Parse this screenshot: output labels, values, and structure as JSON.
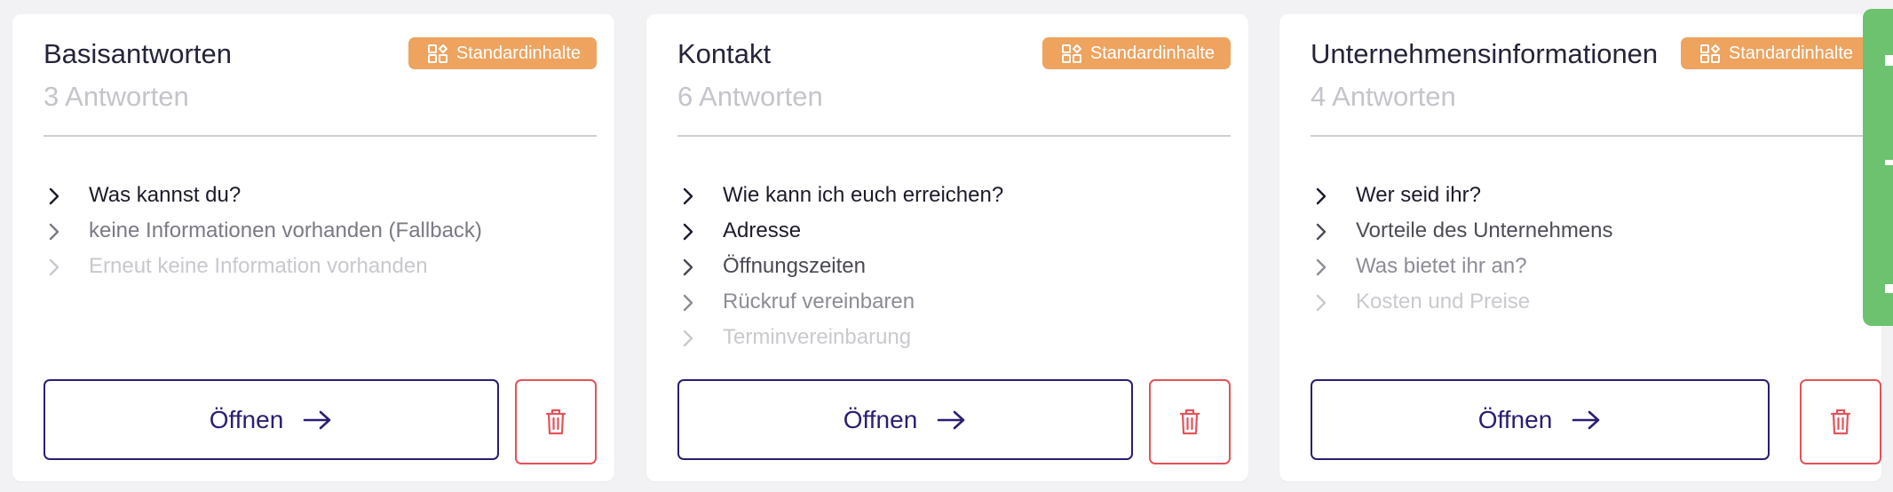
{
  "badge_label": "Standardinhalte",
  "open_label": "Öffnen",
  "icons": {
    "badge": "template-blocks-icon",
    "chevron": "chevron-right-icon",
    "open": "arrow-right-icon",
    "delete": "trash-icon"
  },
  "colors": {
    "badge_bg": "#eea35f",
    "primary": "#2c1d72",
    "danger": "#e2535a",
    "side_tab": "#6cc26e",
    "muted": "#c4c4cb"
  },
  "cards": [
    {
      "title": "Basisantworten",
      "count": "3 Antworten",
      "items": [
        "Was kannst du?",
        "keine Informationen vorhanden (Fallback)",
        "Erneut keine Information vorhanden"
      ]
    },
    {
      "title": "Kontakt",
      "count": "6 Antworten",
      "items": [
        "Wie kann ich euch erreichen?",
        "Adresse",
        "Öffnungszeiten",
        "Rückruf vereinbaren",
        "Terminvereinbarung"
      ]
    },
    {
      "title": "Unternehmensinformationen",
      "count": "4 Antworten",
      "items": [
        "Wer seid ihr?",
        "Vorteile des Unternehmens",
        "Was bietet ihr an?",
        "Kosten und Preise"
      ]
    }
  ]
}
